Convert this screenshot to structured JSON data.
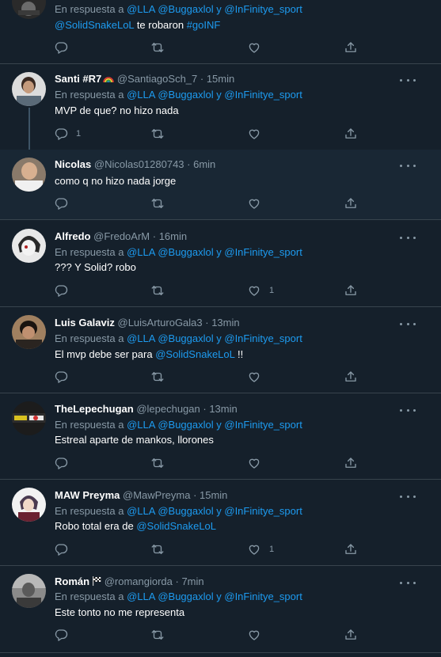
{
  "icons": {
    "reply": "reply-bubble-icon",
    "retweet": "retweet-icon",
    "like": "heart-icon",
    "share": "share-upload-icon",
    "more": "more-dots-icon"
  },
  "colors": {
    "background": "#15202b",
    "highlight_background": "#192734",
    "divider": "#38444d",
    "text_primary": "#ffffff",
    "text_secondary": "#8899a6",
    "link": "#1d9bf0"
  },
  "tweets": [
    {
      "name": "",
      "handle": "",
      "time": "",
      "reply_prefix": "En respuesta a",
      "reply_m1": "@LLA",
      "reply_m2": "@Buggaxlol",
      "reply_conj": "y",
      "reply_m3": "@InFinitye_sport",
      "text_m1": "@SolidSnakeLoL",
      "text_plain": "te robaron",
      "text_m2": "#goINF",
      "replies": "",
      "likes": ""
    },
    {
      "name": "Santi #R7",
      "handle": "@SantiagoSch_7",
      "time": "· 15min",
      "reply_prefix": "En respuesta a",
      "reply_m1": "@LLA",
      "reply_m2": "@Buggaxlol",
      "reply_conj": "y",
      "reply_m3": "@InFinitye_sport",
      "text": "MVP de que? no hizo nada",
      "replies": "1",
      "likes": ""
    },
    {
      "name": "Nicolas",
      "handle": "@Nicolas01280743",
      "time": "· 6min",
      "text": "como  q no hizo nada jorge",
      "replies": "",
      "likes": ""
    },
    {
      "name": "Alfredo",
      "handle": "@FredoArM",
      "time": "· 16min",
      "reply_prefix": "En respuesta a",
      "reply_m1": "@LLA",
      "reply_m2": "@Buggaxlol",
      "reply_conj": "y",
      "reply_m3": "@InFinitye_sport",
      "text": "??? Y Solid? robo",
      "replies": "",
      "likes": "1"
    },
    {
      "name": "Luis Galaviz",
      "handle": "@LuisArturoGala3",
      "time": "· 13min",
      "reply_prefix": "En respuesta a",
      "reply_m1": "@LLA",
      "reply_m2": "@Buggaxlol",
      "reply_conj": "y",
      "reply_m3": "@InFinitye_sport",
      "text_plain": "El mvp debe ser para",
      "text_m1": "@SolidSnakeLoL",
      "text_end": "!!",
      "replies": "",
      "likes": ""
    },
    {
      "name": "TheLepechugan",
      "handle": "@lepechugan",
      "time": "· 13min",
      "reply_prefix": "En respuesta a",
      "reply_m1": "@LLA",
      "reply_m2": "@Buggaxlol",
      "reply_conj": "y",
      "reply_m3": "@InFinitye_sport",
      "text": "Estreal aparte de mankos, llorones",
      "replies": "",
      "likes": ""
    },
    {
      "name": "MAW Preyma",
      "handle": "@MawPreyma",
      "time": "· 15min",
      "reply_prefix": "En respuesta a",
      "reply_m1": "@LLA",
      "reply_m2": "@Buggaxlol",
      "reply_conj": "y",
      "reply_m3": "@InFinitye_sport",
      "text_plain": "Robo total era de",
      "text_m1": "@SolidSnakeLoL",
      "replies": "",
      "likes": "1"
    },
    {
      "name": "Román",
      "handle": "@romangiorda",
      "time": "· 7min",
      "reply_prefix": "En respuesta a",
      "reply_m1": "@LLA",
      "reply_m2": "@Buggaxlol",
      "reply_conj": "y",
      "reply_m3": "@InFinitye_sport",
      "text": "Este tonto no me representa",
      "replies": "",
      "likes": ""
    }
  ]
}
